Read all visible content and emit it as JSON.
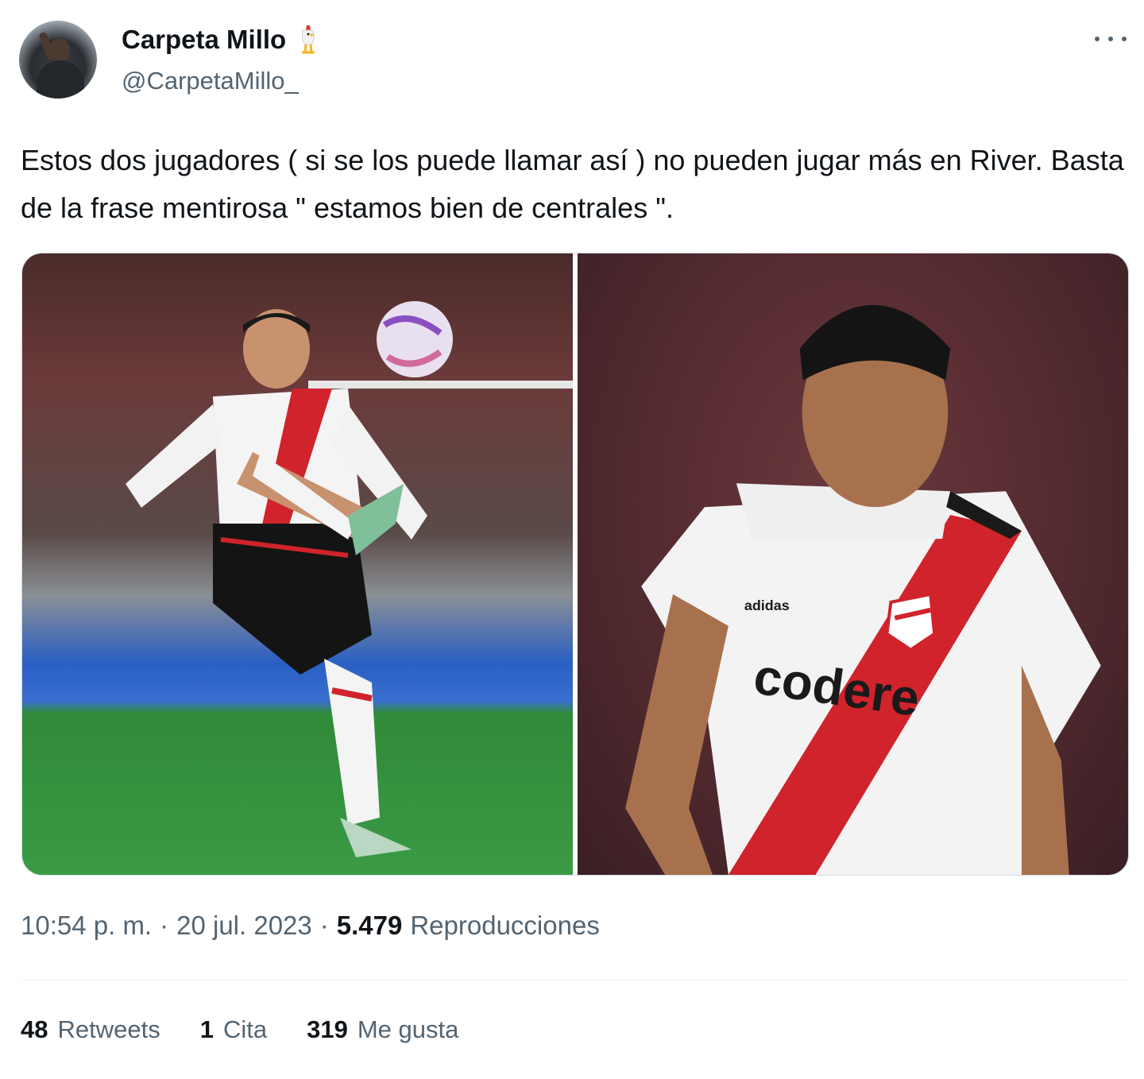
{
  "author": {
    "name": "Carpeta Millo",
    "handle": "@CarpetaMillo_"
  },
  "tweet": {
    "text": "Estos dos jugadores ( si se los puede llamar así ) no pueden jugar más en River. Basta de la frase mentirosa \" estamos bien de centrales \"."
  },
  "media": {
    "right_jersey_sponsor": "codere",
    "right_jersey_brand": "adidas"
  },
  "meta": {
    "time": "10:54 p. m.",
    "sep1": "·",
    "date": "20 jul. 2023",
    "sep2": "·",
    "views_count": "5.479",
    "views_label": "Reproducciones"
  },
  "stats": {
    "retweets_count": "48",
    "retweets_label": "Retweets",
    "quotes_count": "1",
    "quotes_label": "Cita",
    "likes_count": "319",
    "likes_label": "Me gusta"
  },
  "colors": {
    "text_primary": "#0f1419",
    "text_secondary": "#536471",
    "river_red": "#d0232b"
  }
}
